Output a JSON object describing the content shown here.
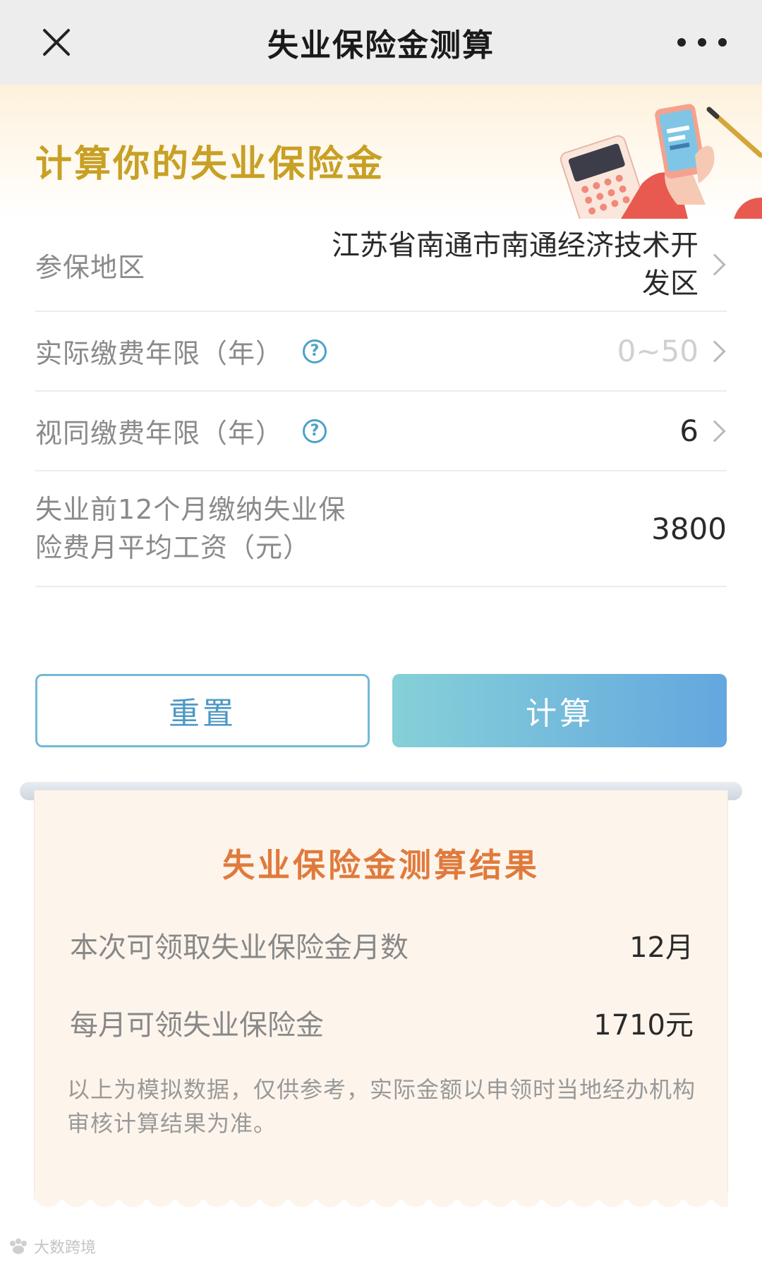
{
  "topbar": {
    "title": "失业保险金测算"
  },
  "hero": {
    "title": "计算你的失业保险金"
  },
  "form": {
    "region": {
      "label": "参保地区",
      "value_line1": "江苏省南通市南通经济技术开",
      "value_line2": "发区"
    },
    "actual_years": {
      "label": "实际缴费年限（年）",
      "placeholder": "0~50"
    },
    "deemed_years": {
      "label": "视同缴费年限（年）",
      "value": "6"
    },
    "avg_wage": {
      "label_line1": "失业前12个月缴纳失业保",
      "label_line2": "险费月平均工资（元）",
      "value": "3800"
    }
  },
  "buttons": {
    "reset": "重置",
    "calculate": "计算"
  },
  "result": {
    "title": "失业保险金测算结果",
    "months_label": "本次可领取失业保险金月数",
    "months_value": "12月",
    "monthly_label": "每月可领失业保险金",
    "monthly_value": "1710元",
    "note": "以上为模拟数据，仅供参考，实际金额以申领时当地经办机构审核计算结果为准。"
  },
  "watermark": "大数跨境",
  "colors": {
    "accent_gold": "#c8a024",
    "result_orange": "#e07a3c",
    "button_blue": "#64a7df"
  }
}
